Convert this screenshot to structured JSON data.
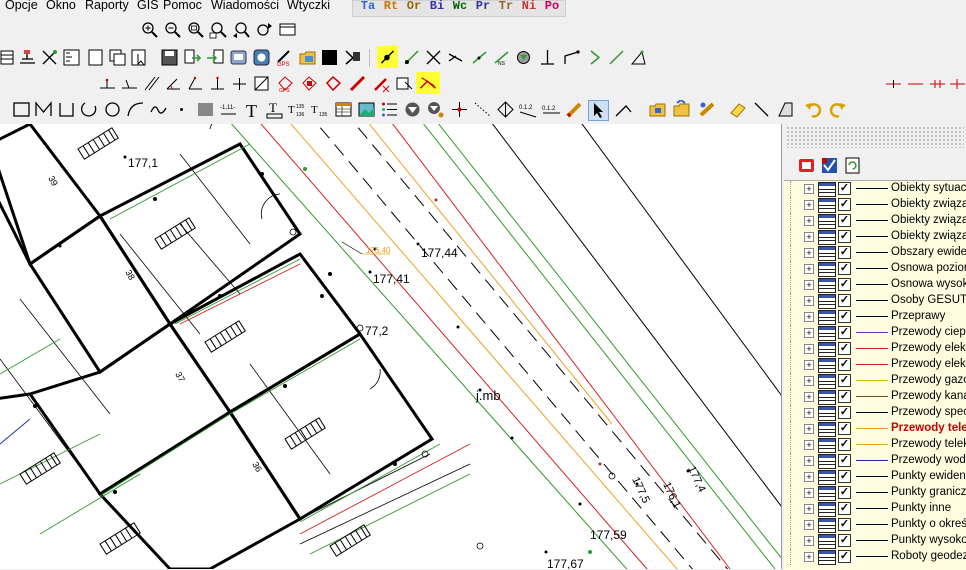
{
  "menu": {
    "items": [
      {
        "label": "Opcje"
      },
      {
        "label": "Okno"
      },
      {
        "label": "Raporty"
      },
      {
        "label": "GIS"
      },
      {
        "label": "Pomoc"
      },
      {
        "label": "Wiadomości"
      },
      {
        "label": "Wtyczki"
      }
    ]
  },
  "layer_tabs": [
    {
      "label": "Ta",
      "color": "#3366cc"
    },
    {
      "label": "Rt",
      "color": "#cc7700"
    },
    {
      "label": "Or",
      "color": "#996600"
    },
    {
      "label": "Bi",
      "color": "#3333aa"
    },
    {
      "label": "Wc",
      "color": "#006600"
    },
    {
      "label": "Pr",
      "color": "#333399"
    },
    {
      "label": "Tr",
      "color": "#996633"
    },
    {
      "label": "Ni",
      "color": "#cc3333"
    },
    {
      "label": "Po",
      "color": "#cc0066"
    }
  ],
  "toolbar_icons": {
    "row1": [
      "zoom-in-icon",
      "zoom-out-icon",
      "zoom-window-icon",
      "zoom-extents-icon",
      "zoom-previous-icon",
      "zoom-next-icon",
      "viewport-icon"
    ],
    "row2": [
      "layers-icon",
      "properties-icon",
      "snap-icon",
      "ruler-icon",
      "page-icon",
      "copy-icon",
      "select-icon",
      "save-icon",
      "export-icon",
      "import-icon",
      "database-icon",
      "gps-icon",
      "folder-icon",
      "fill-color-icon",
      "stamp-icon",
      "point-snap-icon",
      "line-snap-icon",
      "intersection-icon",
      "tangent-icon",
      "perpendicular-icon",
      "parallel-icon",
      "circle-snap-icon",
      "align-icon",
      "node-icon",
      "midpoint-icon",
      "angle-icon",
      "triangle-icon"
    ],
    "row3": [
      "measure-icon",
      "offset-icon",
      "parallel-line-icon",
      "angle-tool-icon",
      "bisector-icon",
      "perpendicular-tool-icon",
      "join-icon",
      "polygon-tool-icon",
      "gps-point-icon",
      "erase-icon",
      "tilt-icon",
      "cut-icon",
      "clip-icon",
      "highlight-cut-icon"
    ],
    "row4": [
      "rectangle-icon",
      "polyline-icon",
      "open-rect-icon",
      "arc-icon",
      "circle-icon",
      "curve-icon",
      "spline-icon",
      "point-icon",
      "hatch-icon",
      "dimension-icon",
      "text-icon",
      "text-box-icon",
      "height-label-icon",
      "height-text-icon",
      "table-icon",
      "image-icon",
      "list-icon",
      "symbol-icon",
      "symbol-dropdown-icon",
      "crosshair-icon",
      "trace-icon",
      "diamond-icon",
      "numbering-icon",
      "pencil-icon",
      "cursor-icon",
      "edit-vertex-icon",
      "open-file-icon",
      "open-layer-icon",
      "edit-object-icon",
      "eraser-icon",
      "line-icon",
      "slope-icon",
      "undo-icon",
      "redo-icon"
    ]
  },
  "map": {
    "labels": [
      "177,1",
      "177,41",
      "177,44",
      "176,40",
      "77,2",
      "j.mb",
      "177,5",
      "176,1",
      "177,4",
      "177,59",
      "177,67",
      "39",
      "38",
      "37",
      "36"
    ]
  },
  "layers": [
    {
      "label": "Obiekty sytuacyj",
      "color": "#000000",
      "bold": false,
      "label_color": "#000000"
    },
    {
      "label": "Obiekty związan",
      "color": "#000000",
      "bold": false,
      "label_color": "#000000"
    },
    {
      "label": "Obiekty związan",
      "color": "#000000",
      "bold": false,
      "label_color": "#000000"
    },
    {
      "label": "Obiekty związan",
      "color": "#000000",
      "bold": false,
      "label_color": "#000000"
    },
    {
      "label": "Obszary ewidenc",
      "color": "#000000",
      "bold": false,
      "label_color": "#000000"
    },
    {
      "label": "Osnowa poziom",
      "color": "#000000",
      "bold": false,
      "label_color": "#000000"
    },
    {
      "label": "Osnowa wysoko",
      "color": "#000000",
      "bold": false,
      "label_color": "#000000"
    },
    {
      "label": "Osoby GESUT",
      "color": "#000000",
      "bold": false,
      "label_color": "#000000"
    },
    {
      "label": "Przeprawy",
      "color": "#000000",
      "bold": false,
      "label_color": "#000000"
    },
    {
      "label": "Przewody ciepln",
      "color": "#7a2fbf",
      "bold": false,
      "label_color": "#000000"
    },
    {
      "label": "Przewody elektr",
      "color": "#d42020",
      "bold": false,
      "label_color": "#000000"
    },
    {
      "label": "Przewody elektr",
      "color": "#d42020",
      "bold": false,
      "label_color": "#000000"
    },
    {
      "label": "Przewody gazow",
      "color": "#e0c000",
      "bold": false,
      "label_color": "#000000"
    },
    {
      "label": "Przewody kanali",
      "color": "#7a4a1a",
      "bold": false,
      "label_color": "#000000"
    },
    {
      "label": "Przewody specja",
      "color": "#000000",
      "bold": false,
      "label_color": "#000000"
    },
    {
      "label": "Przewody tele",
      "color": "#f0a020",
      "bold": true,
      "label_color": "#cc0000"
    },
    {
      "label": "Przewody teleko",
      "color": "#f0a020",
      "bold": false,
      "label_color": "#000000"
    },
    {
      "label": "Przewody wodoc",
      "color": "#1a2aa8",
      "bold": false,
      "label_color": "#000000"
    },
    {
      "label": "Punkty ewidency",
      "color": "#000000",
      "bold": false,
      "label_color": "#000000"
    },
    {
      "label": "Punkty graniczn",
      "color": "#000000",
      "bold": false,
      "label_color": "#000000"
    },
    {
      "label": "Punkty inne",
      "color": "#000000",
      "bold": false,
      "label_color": "#000000"
    },
    {
      "label": "Punkty o określo",
      "color": "#000000",
      "bold": false,
      "label_color": "#000000"
    },
    {
      "label": "Punkty wysokoś",
      "color": "#000000",
      "bold": false,
      "label_color": "#000000"
    },
    {
      "label": "Roboty geodezy",
      "color": "#000000",
      "bold": false,
      "label_color": "#000000"
    }
  ],
  "colors": {
    "highlight": "#ffff33",
    "layer_panel_bg": "#fffde0",
    "green_line": "#2e9a2e",
    "red_line": "#d42020",
    "orange_line": "#f0a020",
    "blue_line": "#1a2aa8"
  }
}
